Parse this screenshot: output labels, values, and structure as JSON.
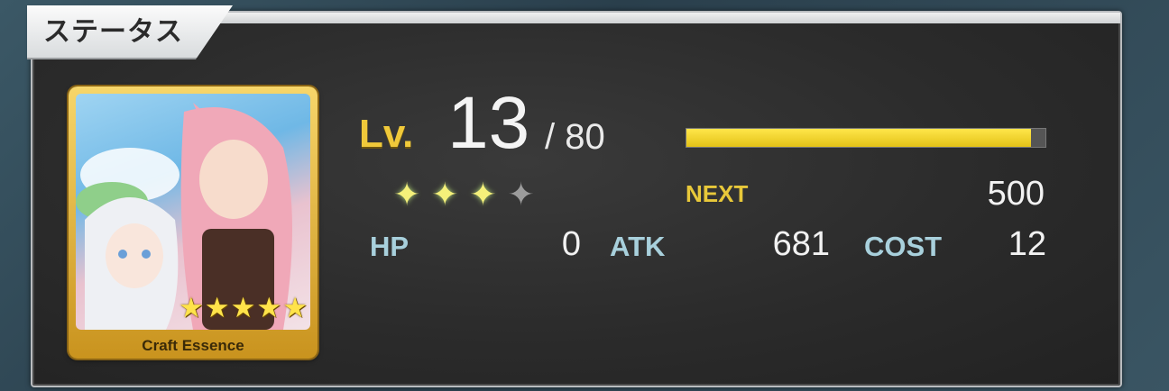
{
  "panel": {
    "title": "ステータス"
  },
  "card": {
    "label": "Craft Essence",
    "rarity_stars": 5
  },
  "level": {
    "label": "Lv.",
    "current": "13",
    "max": "/ 80",
    "exp_progress": 0.96
  },
  "ascension_stars": {
    "filled": 3,
    "total": 4
  },
  "next": {
    "label": "NEXT",
    "value": "500"
  },
  "stats": {
    "hp_label": "HP",
    "hp_value": "0",
    "atk_label": "ATK",
    "atk_value": "681",
    "cost_label": "COST",
    "cost_value": "12"
  },
  "colors": {
    "gold": "#f0c93a",
    "exp_bar": "#ffe64a",
    "stat_label": "#a8d0dc"
  }
}
